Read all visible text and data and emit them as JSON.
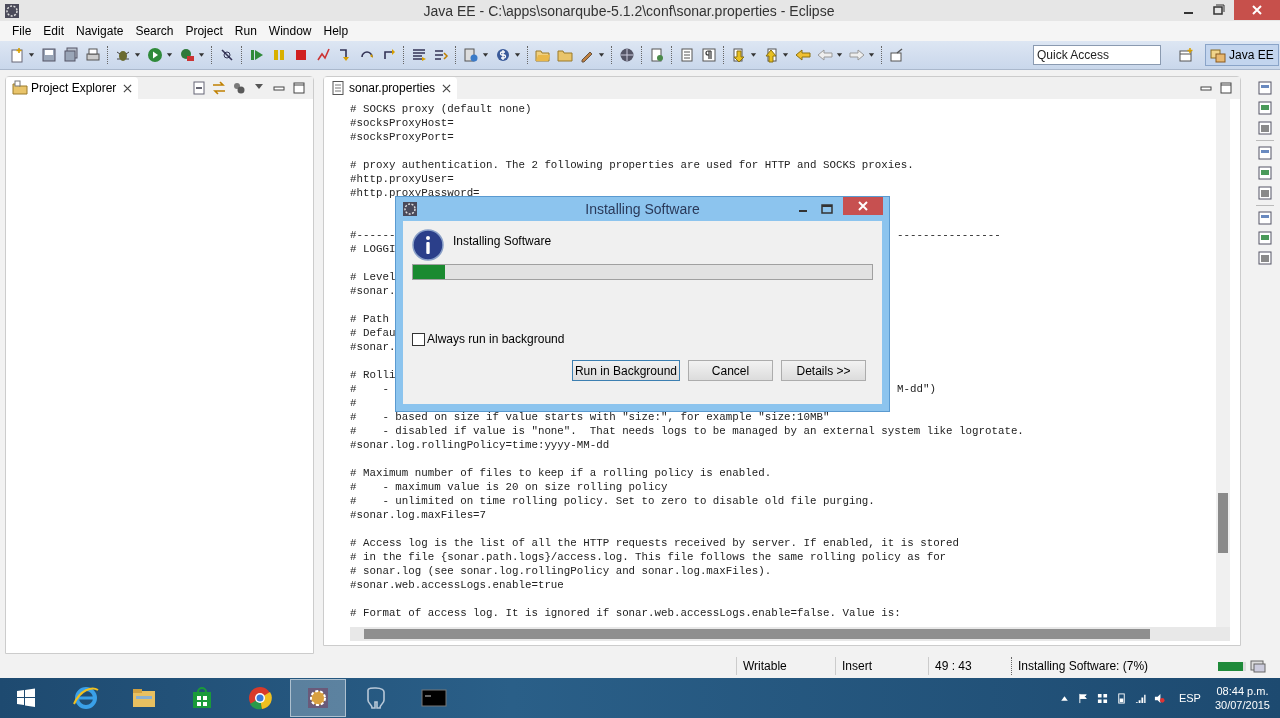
{
  "window": {
    "title": "Java EE - C:\\apps\\sonarqube-5.1.2\\conf\\sonar.properties - Eclipse"
  },
  "menu": [
    "File",
    "Edit",
    "Navigate",
    "Search",
    "Project",
    "Run",
    "Window",
    "Help"
  ],
  "toolbar": {
    "quick_access": {
      "placeholder": "Quick Access"
    },
    "perspective": {
      "label": "Java EE",
      "selected": true
    }
  },
  "project_explorer": {
    "tab": {
      "label": "Project Explorer",
      "selected": true
    }
  },
  "editor": {
    "tabs": [
      {
        "label": "sonar.properties",
        "selected": true
      }
    ],
    "blocks": [
      {
        "section_break": false,
        "lines": [
          "# SOCKS proxy (default none)",
          "#socksProxyHost=",
          "#socksProxyPort="
        ]
      },
      {
        "section_break": false,
        "lines": [
          "# proxy authentication. The 2 following properties are used for HTTP and SOCKS proxies.",
          "#http.proxyUser=",
          "#http.proxyPassword="
        ]
      },
      {
        "section_break": true,
        "lines": [
          {
            "text": "#------",
            "tail": "----------------"
          },
          "# LOGGI"
        ]
      },
      {
        "section_break": false,
        "lines": [
          "# Level",
          "#sonar."
        ]
      },
      {
        "section_break": false,
        "lines": [
          "# Path",
          "# Defau",
          "#sonar."
        ]
      },
      {
        "section_break": false,
        "lines": [
          "# Rolli",
          {
            "text": "#    -",
            "tail": "M-dd\")"
          },
          "#",
          "#    - based on size if value starts with \"size:\", for example \"size:10MB\"",
          "#    - disabled if value is \"none\".  That needs logs to be managed by an external system like logrotate.",
          "#sonar.log.rollingPolicy=time:yyyy-MM-dd"
        ]
      },
      {
        "section_break": false,
        "lines": [
          "# Maximum number of files to keep if a rolling policy is enabled.",
          "#    - maximum value is 20 on size rolling policy",
          "#    - unlimited on time rolling policy. Set to zero to disable old file purging.",
          "#sonar.log.maxFiles=7"
        ]
      },
      {
        "section_break": false,
        "lines": [
          "# Access log is the list of all the HTTP requests received by server. If enabled, it is stored",
          "# in the file {sonar.path.logs}/access.log. This file follows the same rolling policy as for",
          "# sonar.log (see sonar.log.rollingPolicy and sonar.log.maxFiles).",
          "#sonar.web.accessLogs.enable=true"
        ]
      },
      {
        "section_break": false,
        "lines": [
          "# Format of access log. It is ignored if sonar.web.accessLogs.enable=false. Value is:"
        ]
      }
    ]
  },
  "dialog": {
    "title": "Installing Software",
    "message": "Installing Software",
    "progress": {
      "level": 0.07
    },
    "checkbox": {
      "label": "Always run in background",
      "checked": false
    },
    "buttons": [
      {
        "label": "Run in Background",
        "default": true
      },
      {
        "label": "Cancel",
        "default": false
      },
      {
        "label": "Details >>",
        "default": false
      }
    ]
  },
  "status_bar": {
    "mode": "Writable",
    "insert_mode": "Insert",
    "position": "49 : 43",
    "job": "Installing Software: (7%)",
    "job_progress": {
      "level": 0.9
    }
  },
  "taskbar": {
    "apps": [
      {
        "kind": "browser",
        "selected": false
      },
      {
        "kind": "files",
        "selected": false
      },
      {
        "kind": "store",
        "selected": false
      },
      {
        "kind": "chrome",
        "selected": false
      },
      {
        "kind": "eclipse",
        "selected": true
      },
      {
        "kind": "elephant",
        "selected": false
      },
      {
        "kind": "console",
        "selected": false
      }
    ],
    "language": "ESP",
    "time": "08:44 p.m.",
    "date": "30/07/2015"
  }
}
